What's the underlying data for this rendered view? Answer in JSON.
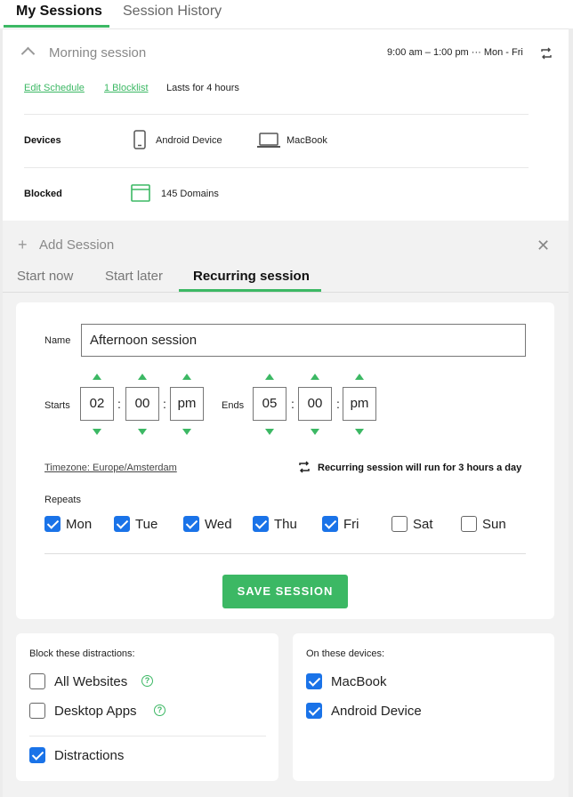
{
  "top_tabs": {
    "my_sessions": "My Sessions",
    "history": "Session History"
  },
  "session": {
    "title": "Morning session",
    "time": "9:00 am – 1:00 pm ··· Mon - Fri",
    "edit_schedule": "Edit Schedule",
    "blocklist": "1 Blocklist",
    "duration": "Lasts for 4 hours",
    "devices_label": "Devices",
    "device_1": "Android Device",
    "device_2": "MacBook",
    "blocked_label": "Blocked",
    "blocked_value": "145 Domains"
  },
  "add_session": {
    "title": "Add Session",
    "tabs": [
      "Start now",
      "Start later",
      "Recurring session"
    ]
  },
  "form": {
    "name_label": "Name",
    "name_value": "Afternoon session",
    "starts_label": "Starts",
    "ends_label": "Ends",
    "start_hour": "02",
    "start_min": "00",
    "start_ampm": "pm",
    "end_hour": "05",
    "end_min": "00",
    "end_ampm": "pm",
    "timezone": "Timezone: Europe/Amsterdam",
    "recurring_note": "Recurring session will run for 3 hours a day",
    "repeats_label": "Repeats",
    "days": [
      {
        "label": "Mon",
        "checked": true
      },
      {
        "label": "Tue",
        "checked": true
      },
      {
        "label": "Wed",
        "checked": true
      },
      {
        "label": "Thu",
        "checked": true
      },
      {
        "label": "Fri",
        "checked": true
      },
      {
        "label": "Sat",
        "checked": false
      },
      {
        "label": "Sun",
        "checked": false
      }
    ],
    "save_label": "SAVE SESSION"
  },
  "distractions": {
    "title": "Block these distractions:",
    "items": [
      {
        "label": "All Websites",
        "checked": false
      },
      {
        "label": "Desktop Apps",
        "checked": false
      },
      {
        "label": "Distractions",
        "checked": true
      }
    ],
    "help_glyph": "?"
  },
  "devices_panel": {
    "title": "On these devices:",
    "items": [
      {
        "label": "MacBook",
        "checked": true
      },
      {
        "label": "Android Device",
        "checked": true
      }
    ]
  },
  "colors": {
    "accent": "#3cb864",
    "checkbox": "#1a73e8"
  }
}
